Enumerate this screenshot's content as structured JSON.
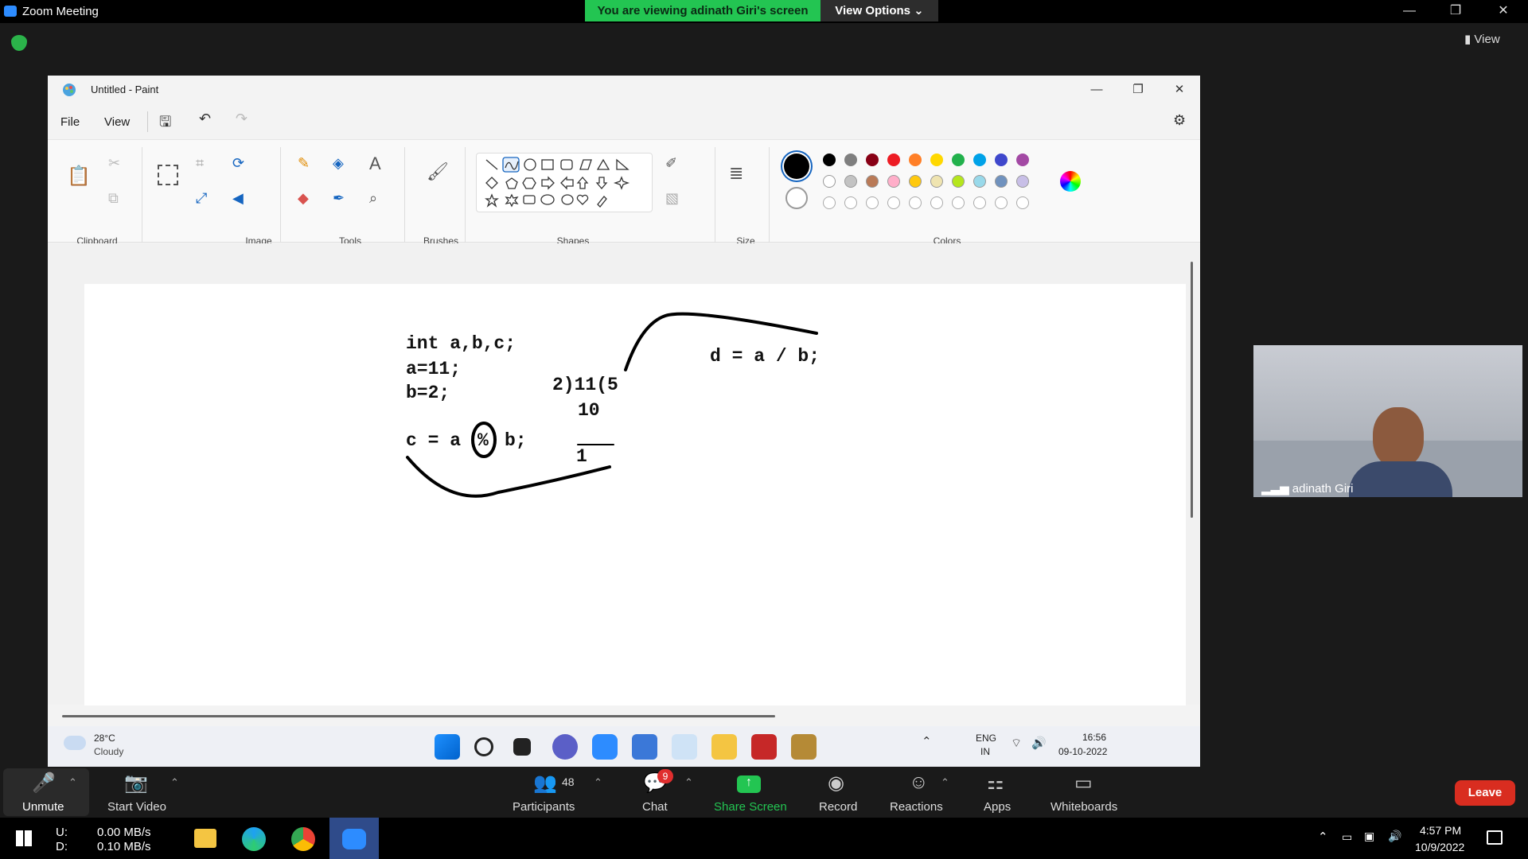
{
  "zoom": {
    "window_title": "Zoom Meeting",
    "banner": "You are viewing adinath Giri's screen",
    "view_options": "View Options ⌄",
    "view_button": "View",
    "controls": [
      "—",
      "❐",
      "✕"
    ]
  },
  "paint": {
    "window_title": "Untitled - Paint",
    "menu": {
      "file": "File",
      "view": "View"
    },
    "groups": [
      "Clipboard",
      "Image",
      "Tools",
      "Brushes",
      "Shapes",
      "Size",
      "Colors"
    ],
    "colors_row1": [
      "#000000",
      "#7f7f7f",
      "#880015",
      "#ed1c24",
      "#ff7f27",
      "#ffd800",
      "#22b14c",
      "#00a2e8",
      "#3f48cc",
      "#a349a4"
    ],
    "colors_row2": [
      "#ffffff",
      "#c3c3c3",
      "#b97a57",
      "#ffaec9",
      "#ffc90e",
      "#efe4b0",
      "#b5e61d",
      "#99d9ea",
      "#7092be",
      "#c8bfe7"
    ],
    "canvas": {
      "line1": "int a,b,c;",
      "line2": "a=11;",
      "line3": "b=2;",
      "line4a": "c = a",
      "line4b": "%",
      "line4c": "b;",
      "div_line1": "2)11(5",
      "div_line2": "10",
      "div_line3": "1",
      "d_line": "d = a  /  b;"
    }
  },
  "inner_taskbar": {
    "weather_temp": "28°C",
    "weather_desc": "Cloudy",
    "lang": "ENG",
    "region": "IN",
    "time": "16:56",
    "date": "09-10-2022"
  },
  "participant": {
    "name": "adinath Giri"
  },
  "toolbar": {
    "unmute": "Unmute",
    "start_video": "Start Video",
    "participants": "Participants",
    "participant_count": "48",
    "chat": "Chat",
    "chat_badge": "9",
    "share_screen": "Share Screen",
    "record": "Record",
    "reactions": "Reactions",
    "apps": "Apps",
    "whiteboards": "Whiteboards",
    "leave": "Leave"
  },
  "host_taskbar": {
    "upload": "U:",
    "download": "D:",
    "upload_rate": "0.00 MB/s",
    "download_rate": "0.10 MB/s",
    "time": "4:57 PM",
    "date": "10/9/2022"
  }
}
